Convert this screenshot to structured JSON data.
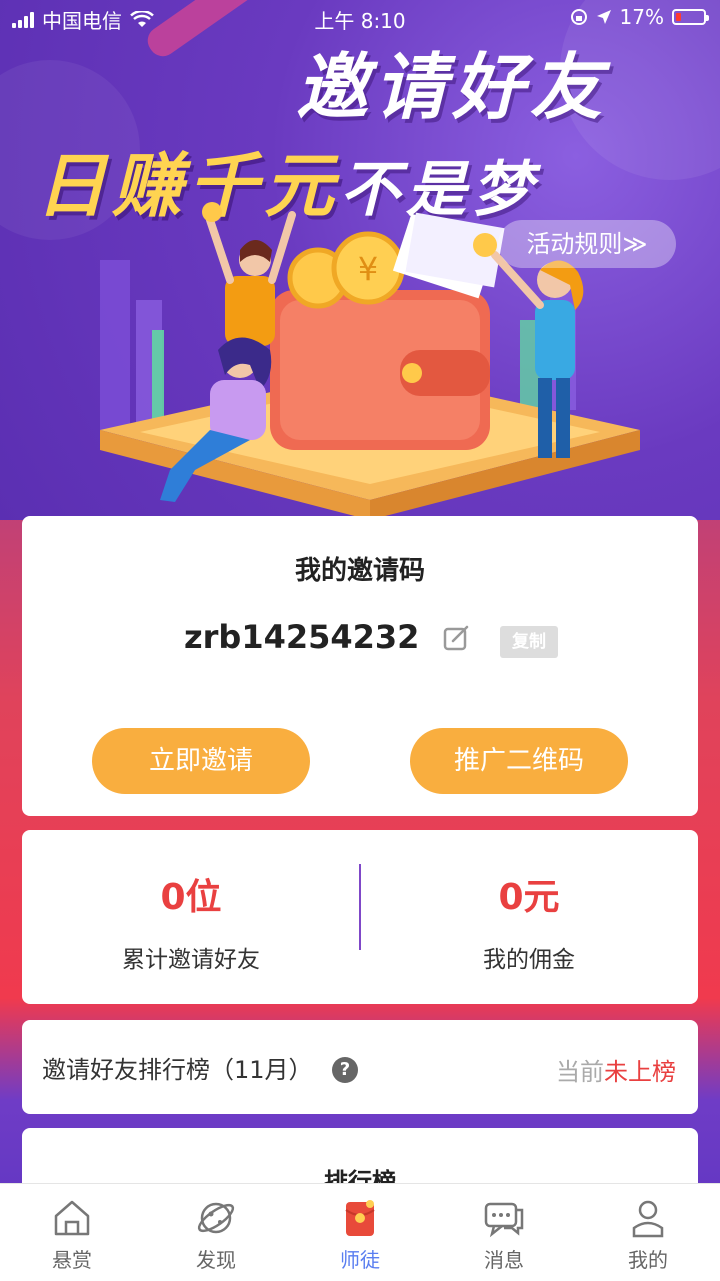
{
  "status_bar": {
    "carrier": "中国电信",
    "time": "上午 8:10",
    "battery": "17%"
  },
  "banner": {
    "headline_line1": "邀请好友",
    "headline_gold": "日赚千元",
    "headline_white": "不是梦",
    "rules_button": "活动规则≫"
  },
  "invite_card": {
    "title": "我的邀请码",
    "code": "zrb14254232",
    "copy_label": "复制",
    "invite_button": "立即邀请",
    "qr_button": "推广二维码"
  },
  "stats": {
    "friends_value": "0位",
    "friends_label": "累计邀请好友",
    "commission_value": "0元",
    "commission_label": "我的佣金"
  },
  "leaderboard_row": {
    "label": "邀请好友排行榜（11月）",
    "help_icon": "?",
    "status_prefix": "当前",
    "status_value": "未上榜"
  },
  "ranking_card": {
    "title": "排行榜"
  },
  "tabs": [
    {
      "label": "悬赏",
      "icon": "home-icon"
    },
    {
      "label": "发现",
      "icon": "planet-icon"
    },
    {
      "label": "师徒",
      "icon": "red-envelope-icon"
    },
    {
      "label": "消息",
      "icon": "chat-icon"
    },
    {
      "label": "我的",
      "icon": "user-icon"
    }
  ],
  "colors": {
    "accent_orange": "#f9ae3f",
    "value_red": "#e94040",
    "active_tab_blue": "#5a7ef0",
    "divider_purple": "#7f48c8"
  }
}
